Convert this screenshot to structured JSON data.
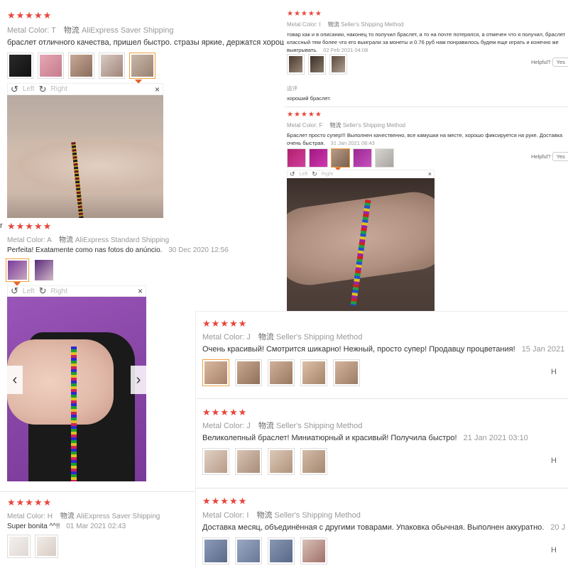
{
  "colors": {
    "star": "#e8453c",
    "selected_border": "#f0a040",
    "text": "#333333",
    "muted": "#999999"
  },
  "stars": "★★★★★",
  "shipping_key": "物流",
  "viewer": {
    "left": "Left",
    "right": "Right",
    "close": "×",
    "rotate_left_icon": "↺",
    "rotate_right_icon": "↻",
    "prev_icon": "‹",
    "next_icon": "›"
  },
  "helpful": {
    "label": "Helpful?",
    "yes": "Yes"
  },
  "left_column": {
    "review_1": {
      "metal_label": "Metal Color:",
      "metal_value": "T",
      "shipping": "AliExpress Saver Shipping",
      "text": "браслет отличного качества, пришел быстро. стразы яркие, держатся хорошо."
    },
    "review_2": {
      "metal_label": "Metal Color:",
      "metal_value": "A",
      "shipping": "AliExpress Standard Shipping",
      "text": "Perfeita! Exatamente como nas fotos do anúncio.",
      "date": "30 Dec 2020 12:56",
      "edge_letter": "r"
    },
    "review_3": {
      "metal_label": "Metal Color:",
      "metal_value": "H",
      "shipping": "AliExpress Saver Shipping",
      "text": "Super bonita ^^!!",
      "date": "01 Mar 2021 02:43"
    }
  },
  "right_top": {
    "review_1": {
      "metal_label": "Metal Color:",
      "metal_value": "I",
      "shipping": "Seller's Shipping Method",
      "text_line1": "товар как и в описании, наконец то получил браслет, а то на почте потерялся, а отмечен что я получил, браслет",
      "text_line2": "классный тем более что его выиграли за монеты и 0.76 руб нам понравилось будем еще играть и конечно же",
      "text_line3": "выигрывать.",
      "date": "02 Feb 2021 04:08",
      "followup_label": "追评",
      "followup_text": "хороший браслет."
    },
    "review_2": {
      "metal_label": "Metal Color:",
      "metal_value": "F",
      "shipping": "Seller's Shipping Method",
      "text_line1": "Браслет просто супер!!! Выполнен качественно, все камушки на месте, хорошо фиксируется на руке. Доставка",
      "text_line2": "очень быстрая.",
      "date": "31 Jan 2021 06:43"
    }
  },
  "bottom_right": {
    "review_1": {
      "metal_label": "Metal Color:",
      "metal_value": "J",
      "shipping": "Seller's Shipping Method",
      "text": "Очень красивый! Смотрится шикарно! Нежный, просто супер! Продавцу процветания!",
      "date": "15 Jan 2021",
      "edge": "H"
    },
    "review_2": {
      "metal_label": "Metal Color:",
      "metal_value": "J",
      "shipping": "Seller's Shipping Method",
      "text": "Великолепный браслет! Миниатюрный и красивый! Получила быстро!",
      "date": "21 Jan 2021 03:10",
      "edge": "H"
    },
    "review_3": {
      "metal_label": "Metal Color:",
      "metal_value": "I",
      "shipping": "Seller's Shipping Method",
      "text": "Доставка месяц, объединённая с другими товарами. Упаковка обычная. Выполнен аккуратно.",
      "date": "20 J",
      "edge": "H"
    }
  }
}
